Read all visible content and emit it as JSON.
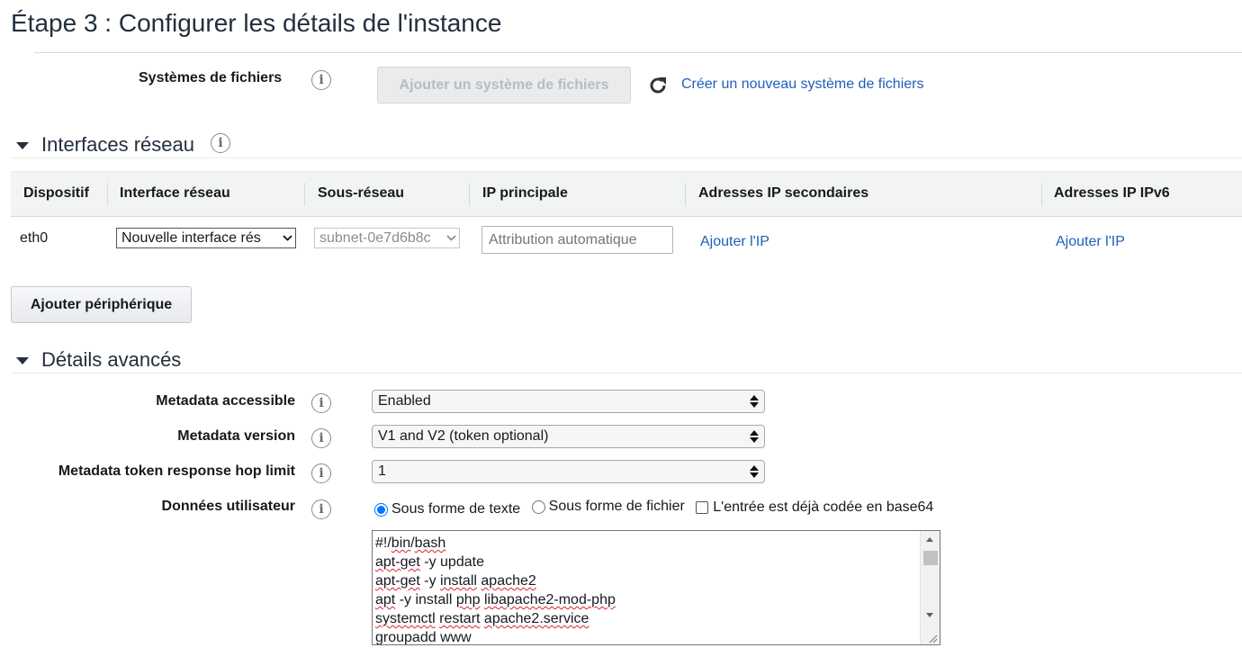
{
  "page": {
    "title": "Étape 3 : Configurer les détails de l'instance"
  },
  "filesystems": {
    "label": "Systèmes de fichiers",
    "add_button": "Ajouter un système de fichiers",
    "create_link": "Créer un nouveau système de fichiers",
    "icons": {
      "info": "info-icon",
      "refresh": "refresh-icon"
    }
  },
  "network": {
    "section_title": "Interfaces réseau",
    "columns": [
      "Dispositif",
      "Interface réseau",
      "Sous-réseau",
      "IP principale",
      "Adresses IP secondaires",
      "Adresses IP IPv6"
    ],
    "row": {
      "device": "eth0",
      "interface_value": "Nouvelle interface rés",
      "subnet_value": "subnet-0e7d6b8c",
      "primary_ip_placeholder": "Attribution automatique",
      "secondary_ip_link": "Ajouter l'IP",
      "ipv6_link": "Ajouter l'IP"
    },
    "add_device_button": "Ajouter périphérique"
  },
  "advanced": {
    "section_title": "Détails avancés",
    "metadata_accessible": {
      "label": "Metadata accessible",
      "value": "Enabled"
    },
    "metadata_version": {
      "label": "Metadata version",
      "value": "V1 and V2 (token optional)"
    },
    "hop_limit": {
      "label": "Metadata token response hop limit",
      "value": "1"
    },
    "user_data": {
      "label": "Données utilisateur",
      "option_text": "Sous forme de texte",
      "option_file": "Sous forme de fichier",
      "base64_checkbox": "L'entrée est déjà codée en base64",
      "selected": "text",
      "base64_checked": false
    }
  },
  "colors": {
    "link": "#1f5fb8",
    "radio_accent": "#0075ff",
    "header_bg": "#f2f3f3",
    "disabled_button_text": "#b8bcc0"
  }
}
